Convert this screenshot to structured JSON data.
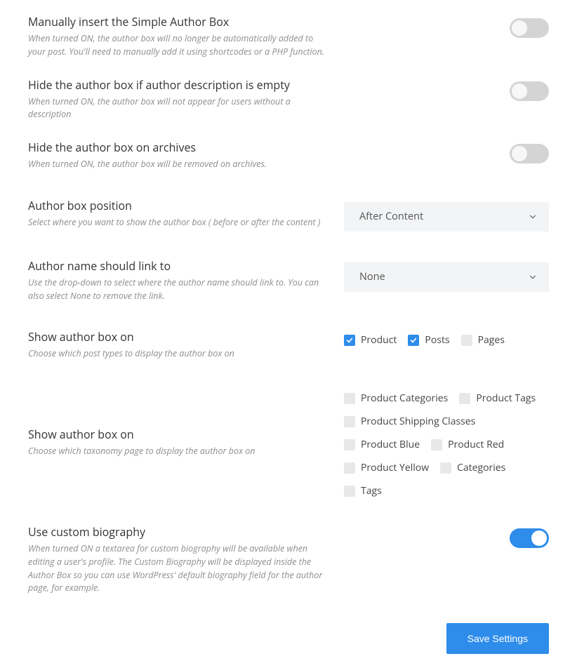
{
  "settings": {
    "manual_insert": {
      "title": "Manually insert the Simple Author Box",
      "desc": "When turned ON, the author box will no longer be automatically added to your post. You'll need to manually add it using shortcodes or a PHP function.",
      "value": false
    },
    "hide_empty_desc": {
      "title": "Hide the author box if author description is empty",
      "desc": "When turned ON, the author box will not appear for users without a description",
      "value": false
    },
    "hide_archives": {
      "title": "Hide the author box on archives",
      "desc": "When turned ON, the author box will be removed on archives.",
      "value": false
    },
    "position": {
      "title": "Author box position",
      "desc": "Select where you want to show the author box ( before or after the content )",
      "value": "After Content"
    },
    "name_link": {
      "title": "Author name should link to",
      "desc": "Use the drop-down to select where the author name should link to. You can also select None to remove the link.",
      "value": "None"
    },
    "show_on_post_types": {
      "title": "Show author box on",
      "desc": "Choose which post types to display the author box on",
      "options": [
        {
          "label": "Product",
          "checked": true
        },
        {
          "label": "Posts",
          "checked": true
        },
        {
          "label": "Pages",
          "checked": false
        }
      ]
    },
    "show_on_taxonomies": {
      "title": "Show author box on",
      "desc": "Choose which taxonomy page to display the author box on",
      "options": [
        {
          "label": "Product Categories",
          "checked": false
        },
        {
          "label": "Product Tags",
          "checked": false
        },
        {
          "label": "Product Shipping Classes",
          "checked": false
        },
        {
          "label": "Product Blue",
          "checked": false
        },
        {
          "label": "Product Red",
          "checked": false
        },
        {
          "label": "Product Yellow",
          "checked": false
        },
        {
          "label": "Categories",
          "checked": false
        },
        {
          "label": "Tags",
          "checked": false
        }
      ]
    },
    "custom_bio": {
      "title": "Use custom biography",
      "desc": "When turned ON a textarea for custom biography will be available when editing a user's profile. The Custom Biography will be displayed inside the Author Box so you can use WordPress' default biography field for the author page, for example.",
      "value": true
    }
  },
  "actions": {
    "save_label": "Save Settings"
  }
}
